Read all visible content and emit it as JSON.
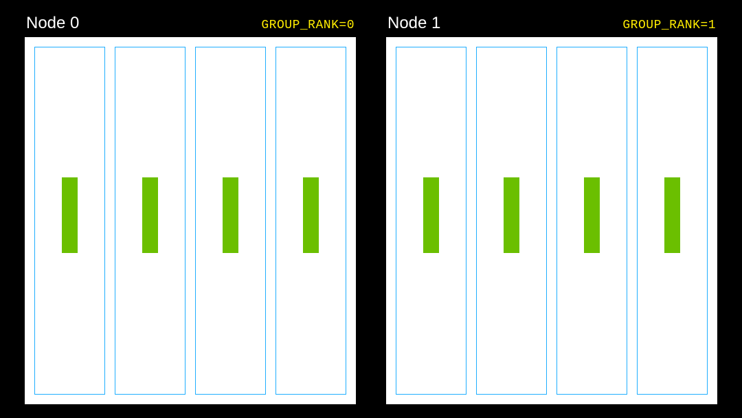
{
  "nodes": [
    {
      "title": "Node 0",
      "group_rank": "GROUP_RANK=0",
      "slot_count": 4
    },
    {
      "title": "Node 1",
      "group_rank": "GROUP_RANK=1",
      "slot_count": 4
    }
  ],
  "colors": {
    "bg": "#000000",
    "panel": "#ffffff",
    "slot_border": "#1faeff",
    "bar": "#6bbf00",
    "rank_text": "#ffed00",
    "title_text": "#ffffff"
  }
}
